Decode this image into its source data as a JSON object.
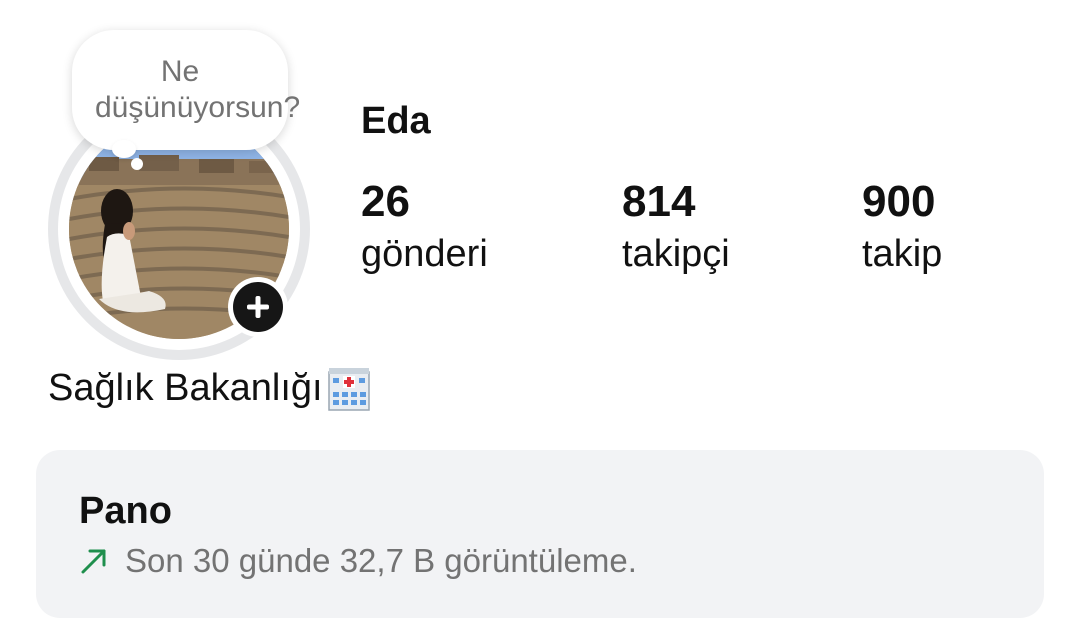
{
  "profile": {
    "name": "Eda",
    "note_placeholder": "Ne düşünüyorsun?",
    "bio": "Sağlık Bakanlığı",
    "bio_emoji": "hospital-icon"
  },
  "stats": {
    "posts": {
      "count": "26",
      "label": "gönderi"
    },
    "followers": {
      "count": "814",
      "label": "takipçi"
    },
    "following": {
      "count": "900",
      "label": "takip"
    }
  },
  "dashboard": {
    "title": "Pano",
    "subtitle": "Son 30 günde 32,7 B görüntüleme.",
    "trend_icon": "trend-up-arrow-icon",
    "trend_color": "#1f8f4d"
  },
  "colors": {
    "text_primary": "#111111",
    "text_secondary": "#737373",
    "card_background": "#f2f3f5",
    "add_button": "#161616"
  }
}
